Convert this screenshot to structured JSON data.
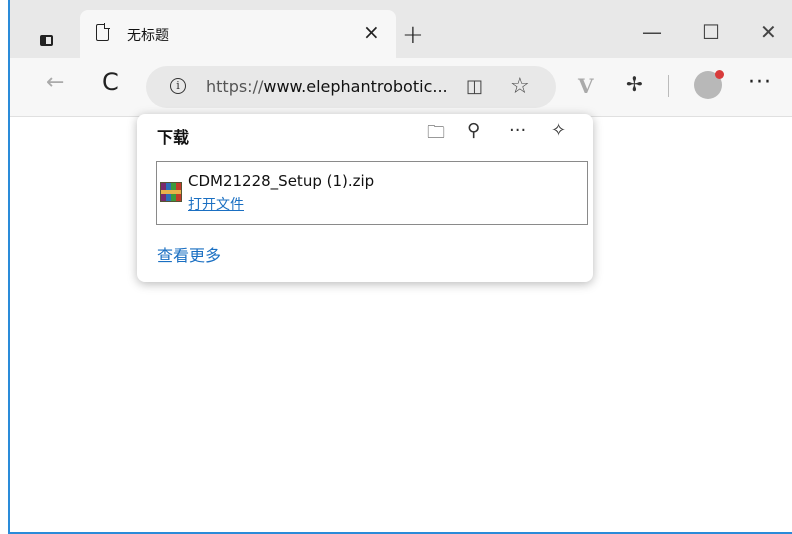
{
  "tab": {
    "title": "无标题",
    "close": "×"
  },
  "new_tab": "+",
  "window_controls": {
    "minimize": "—",
    "maximize": "☐",
    "close": "✕"
  },
  "toolbar": {
    "back": "←",
    "refresh": "C"
  },
  "address": {
    "url_prefix": "https://",
    "url_domain": "www.elephantrobotic..."
  },
  "icons": {
    "reader": "◫",
    "favorite": "☆",
    "extension_v": "V",
    "puzzle": "✢",
    "more": "···"
  },
  "downloads": {
    "title": "下载",
    "tools": {
      "folder": "🗀",
      "search": "⚲",
      "more": "···",
      "pin": "✧"
    },
    "items": [
      {
        "file_name": "CDM21228_Setup (1).zip",
        "action": "打开文件"
      }
    ],
    "see_more": "查看更多"
  },
  "colors": {
    "link": "#1a6fc2",
    "window_accent": "#2a8bd9"
  }
}
